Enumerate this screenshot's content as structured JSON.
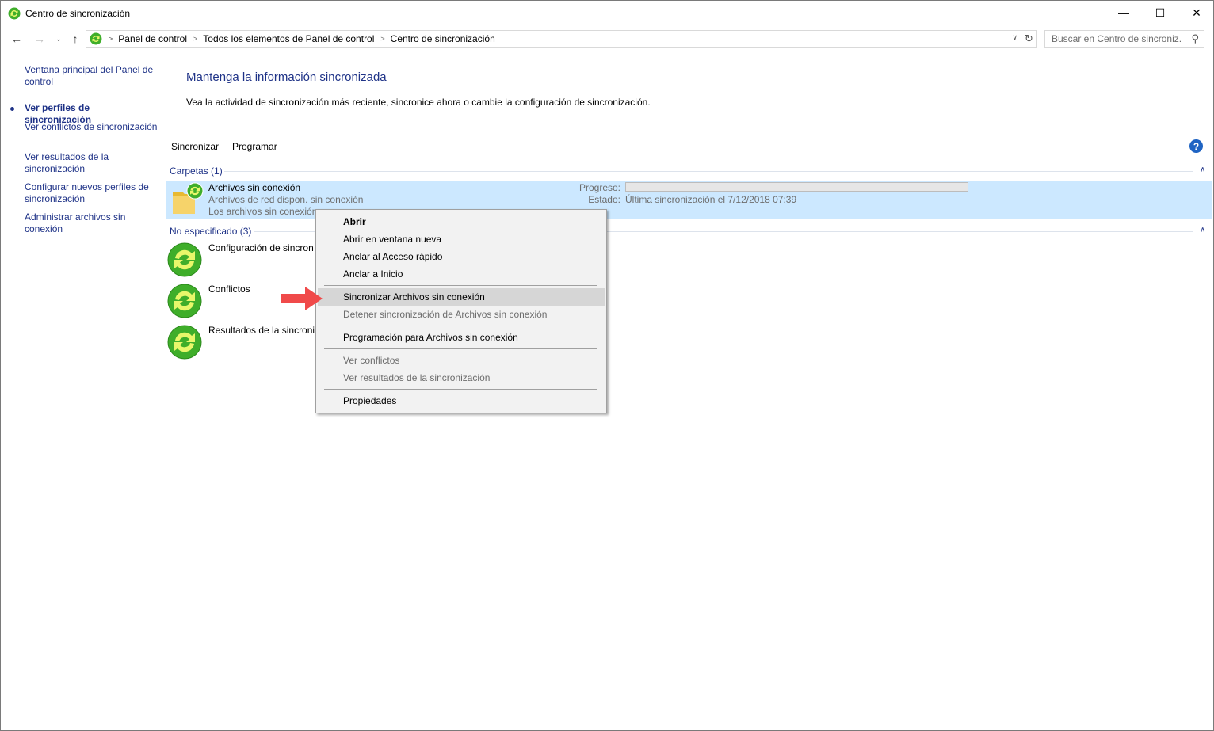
{
  "window": {
    "title": "Centro de sincronización"
  },
  "titlebar_controls": {
    "minimize": "—",
    "maximize": "☐",
    "close": "✕"
  },
  "nav": {
    "back": "←",
    "forward": "→",
    "recent": "⌄",
    "up": "↑",
    "breadcrumbs": [
      "Panel de control",
      "Todos los elementos de Panel de control",
      "Centro de sincronización"
    ],
    "refresh": "↻",
    "search_placeholder": "Buscar en Centro de sincroniz...",
    "search_icon": "⚲"
  },
  "sidebar": {
    "items": [
      {
        "label": "Ventana principal del Panel de control"
      },
      {
        "label": "Ver perfiles de sincronización",
        "current": true
      },
      {
        "label": "Ver conflictos de sincronización"
      },
      {
        "label": "Ver resultados de la sincronización"
      },
      {
        "label": "Configurar nuevos perfiles de sincronización"
      },
      {
        "label": "Administrar archivos sin conexión"
      }
    ]
  },
  "main": {
    "title": "Mantenga la información sincronizada",
    "description": "Vea la actividad de sincronización más reciente, sincronice ahora o cambie la configuración de sincronización.",
    "toolbar": {
      "sync": "Sincronizar",
      "schedule": "Programar",
      "help": "?"
    }
  },
  "groups": [
    {
      "header": "Carpetas (1)",
      "items": [
        {
          "name": "Archivos sin conexión",
          "line2": "Archivos de red dispon. sin conexión",
          "line3": "Los archivos sin conexión",
          "progress_label": "Progreso:",
          "progress": 0,
          "status_label": "Estado:",
          "status": "Última sincronización el 7/12/2018 07:39"
        }
      ]
    },
    {
      "header": "No especificado (3)",
      "items": [
        {
          "name": "Configuración de sincron"
        },
        {
          "name": "Conflictos"
        },
        {
          "name": "Resultados de la sincroniz"
        }
      ]
    }
  ],
  "context_menu": {
    "items": [
      {
        "label": "Abrir",
        "bold": true
      },
      {
        "label": "Abrir en ventana nueva"
      },
      {
        "label": "Anclar al Acceso rápido"
      },
      {
        "label": "Anclar a Inicio"
      },
      {
        "label": "Sincronizar Archivos sin conexión",
        "highlight": true
      },
      {
        "label": "Detener sincronización de Archivos sin conexión",
        "disabled": true
      },
      {
        "label": "Programación para Archivos sin conexión"
      },
      {
        "label": "Ver conflictos",
        "disabled": true
      },
      {
        "label": "Ver resultados de la sincronización",
        "disabled": true
      },
      {
        "label": "Propiedades"
      }
    ]
  },
  "colors": {
    "link": "#1e3287",
    "selection": "#cce8ff",
    "menu_bg": "#f2f2f2",
    "sync_green": "#3fae2a",
    "arrow": "#f04a4a"
  }
}
